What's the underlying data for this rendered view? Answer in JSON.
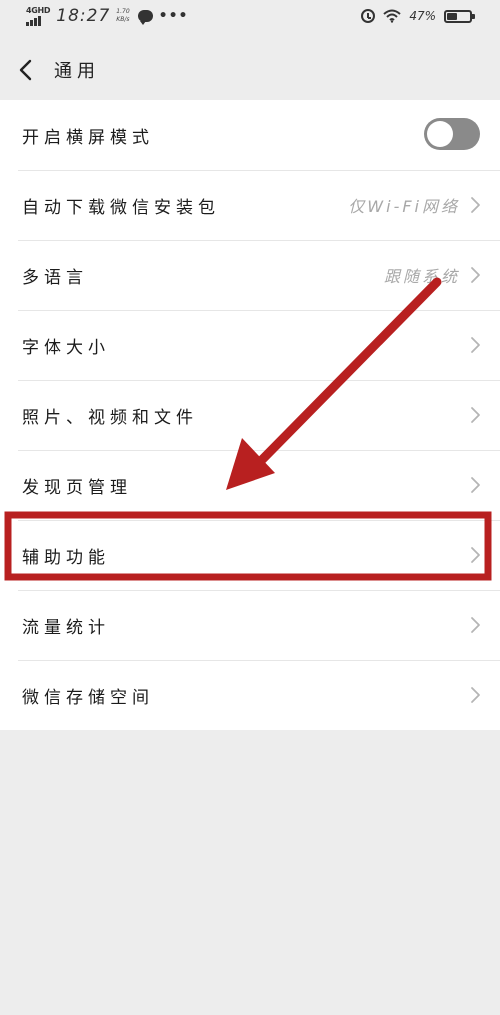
{
  "status_bar": {
    "network": "4GHD",
    "time": "18:27",
    "speed_value": "1.70",
    "speed_unit": "KB/s",
    "more": "•••",
    "battery": "47%",
    "battery_level": 0.47
  },
  "header": {
    "title": "通用"
  },
  "settings": [
    {
      "label": "开启横屏模式",
      "type": "toggle",
      "on": false
    },
    {
      "label": "自动下载微信安装包",
      "value": "仅Wi-Fi网络",
      "type": "link"
    },
    {
      "label": "多语言",
      "value": "跟随系统",
      "type": "link"
    },
    {
      "label": "字体大小",
      "type": "link"
    },
    {
      "label": "照片、视频和文件",
      "type": "link"
    },
    {
      "label": "发现页管理",
      "type": "link"
    },
    {
      "label": "辅助功能",
      "type": "link",
      "highlighted": true
    },
    {
      "label": "流量统计",
      "type": "link"
    },
    {
      "label": "微信存储空间",
      "type": "link"
    }
  ],
  "colors": {
    "background": "#ededed",
    "list_background": "#ffffff",
    "annotation_red": "#b82020",
    "toggle_off": "#8a8a8a",
    "secondary_text": "#a8a8a8"
  },
  "icons": {
    "back": "chevron-left-icon",
    "row_arrow": "chevron-right-icon",
    "status": [
      "signal-icon",
      "chat-bubble-icon",
      "alarm-icon",
      "wifi-icon",
      "battery-icon"
    ]
  }
}
